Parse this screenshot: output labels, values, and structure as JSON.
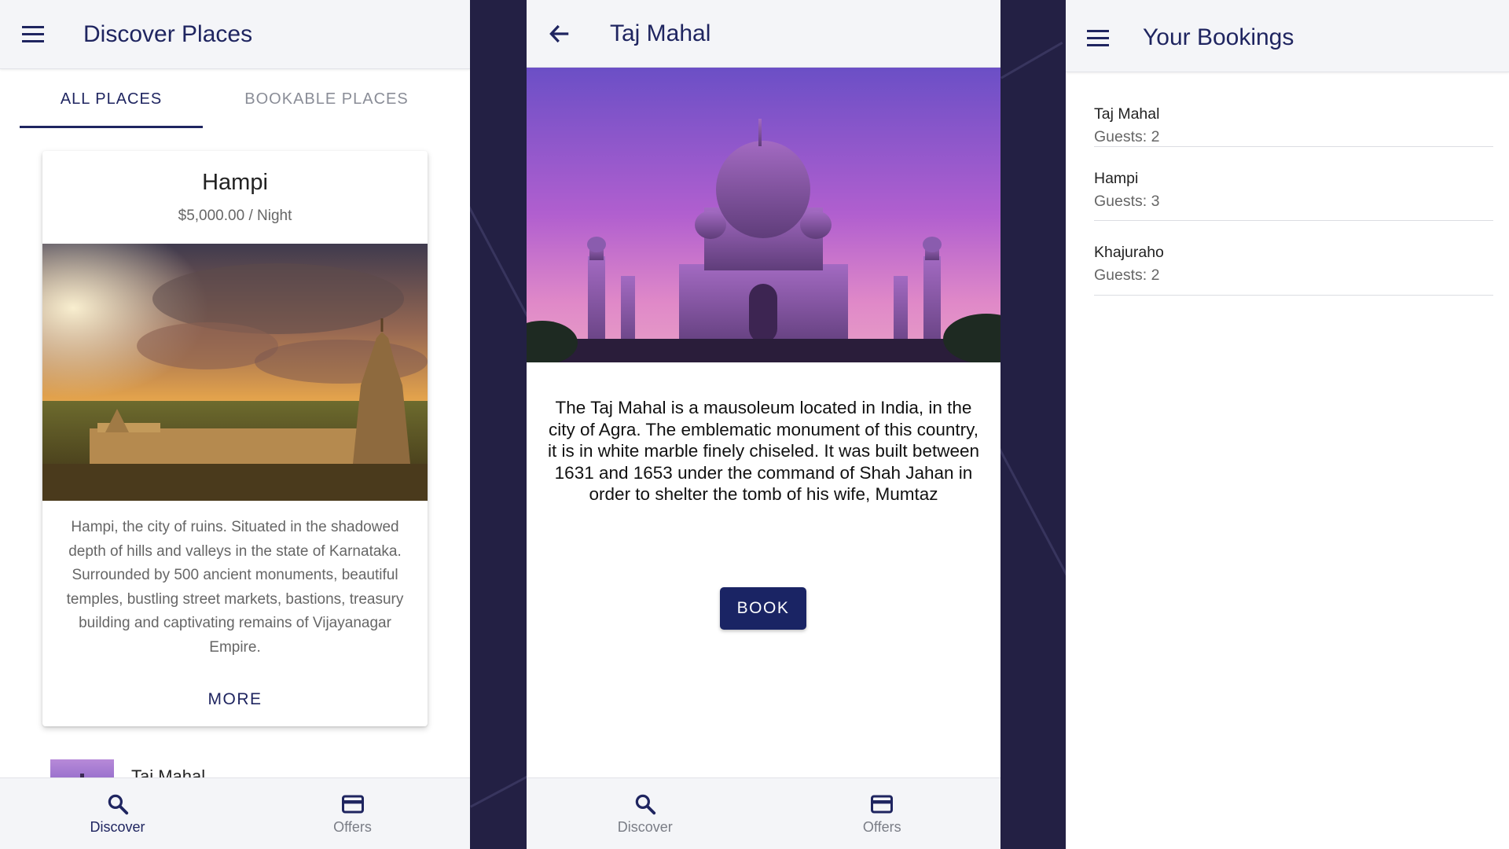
{
  "colors": {
    "primary": "#1f2560",
    "book_button": "#1a2464",
    "background": "#232044",
    "toolbar": "#f4f5f8"
  },
  "discover_screen": {
    "header": {
      "title": "Discover Places",
      "menu_icon": "menu-icon"
    },
    "segments": [
      {
        "label": "ALL PLACES",
        "active": true
      },
      {
        "label": "BOOKABLE PLACES",
        "active": false
      }
    ],
    "featured_card": {
      "title": "Hampi",
      "price": "$5,000.00 / Night",
      "description": "Hampi, the city of ruins. Situated in the shadowed depth of hills and valleys in the state of Karnataka. Surrounded by 500 ancient monuments, beautiful temples, bustling street markets, bastions, treasury building and captivating remains of Vijayanagar Empire.",
      "more_label": "MORE"
    },
    "list_items": [
      {
        "title": "Taj Mahal"
      }
    ],
    "tabs": [
      {
        "label": "Discover",
        "icon": "search-icon",
        "selected": true
      },
      {
        "label": "Offers",
        "icon": "card-icon",
        "selected": false
      }
    ]
  },
  "detail_screen": {
    "header": {
      "title": "Taj Mahal",
      "back_icon": "arrow-back-icon"
    },
    "description": "The Taj Mahal is a mausoleum located in India, in the city of Agra. The emblematic monument of this country, it is in white marble finely chiseled. It was built between 1631 and 1653 under the command of Shah Jahan in order to shelter the tomb of his wife, Mumtaz",
    "book_label": "BOOK",
    "tabs": [
      {
        "label": "Discover",
        "icon": "search-icon"
      },
      {
        "label": "Offers",
        "icon": "card-icon"
      }
    ]
  },
  "bookings_screen": {
    "header": {
      "title": "Your Bookings",
      "menu_icon": "menu-icon"
    },
    "bookings": [
      {
        "place": "Taj Mahal",
        "guests": "Guests: 2"
      },
      {
        "place": "Hampi",
        "guests": "Guests: 3"
      },
      {
        "place": "Khajuraho",
        "guests": "Guests: 2"
      }
    ]
  }
}
